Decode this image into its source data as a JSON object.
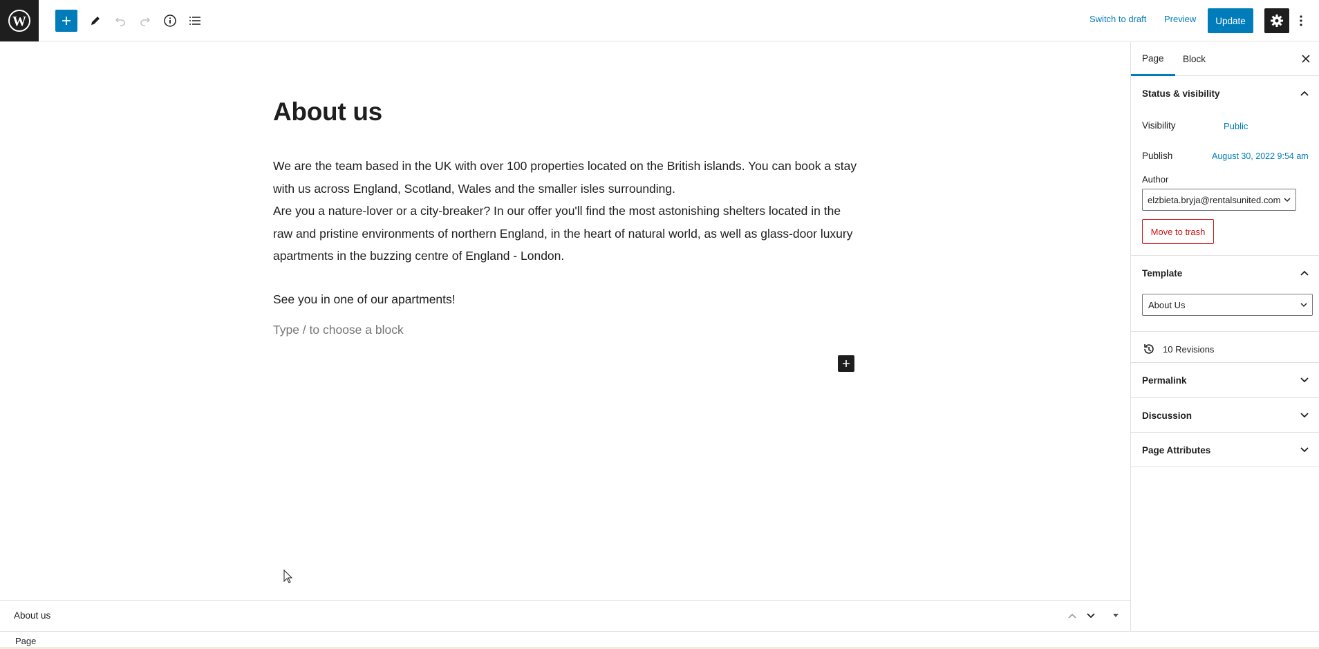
{
  "toolbar": {
    "logo": "wordpress-icon",
    "add_block_icon": "plus-icon",
    "tools_icon": "pencil-icon",
    "undo_icon": "undo-icon",
    "redo_icon": "redo-icon",
    "details_icon": "info-icon",
    "list_view_icon": "list-view-icon",
    "switch_to_draft": "Switch to draft",
    "preview": "Preview",
    "update": "Update",
    "settings_icon": "gear-icon",
    "more_icon": "vertical-ellipsis-icon",
    "accent_color": "#007cba"
  },
  "editor": {
    "title": "About us",
    "paragraph1": "We are the team based in the UK with over 100 properties located on the British islands. You can book a stay with us across England, Scotland, Wales and the smaller isles surrounding.\nAre you a nature-lover or a city-breaker? In our offer you'll find the most astonishing shelters located in the raw and pristine environments of northern England, in the heart of natural world, as well as glass-door luxury apartments in the buzzing centre of England - London.",
    "paragraph2": "See you in one of our apartments!",
    "placeholder": "Type / to choose a block"
  },
  "footer": {
    "block_title": "About us",
    "breadcrumb": "Page"
  },
  "sidebar": {
    "tabs": [
      {
        "label": "Page",
        "active": true
      },
      {
        "label": "Block",
        "active": false
      }
    ],
    "status_visibility": {
      "heading": "Status & visibility",
      "visibility_label": "Visibility",
      "visibility_value": "Public",
      "publish_label": "Publish",
      "publish_value": "August 30, 2022 9:54 am",
      "author_label": "Author",
      "author_value": "elzbieta.bryja@rentalsunited.com",
      "trash_label": "Move to trash"
    },
    "template": {
      "heading": "Template",
      "value": "About Us"
    },
    "revisions": "10 Revisions",
    "panels": [
      {
        "label": "Permalink"
      },
      {
        "label": "Discussion"
      },
      {
        "label": "Page Attributes"
      }
    ]
  }
}
